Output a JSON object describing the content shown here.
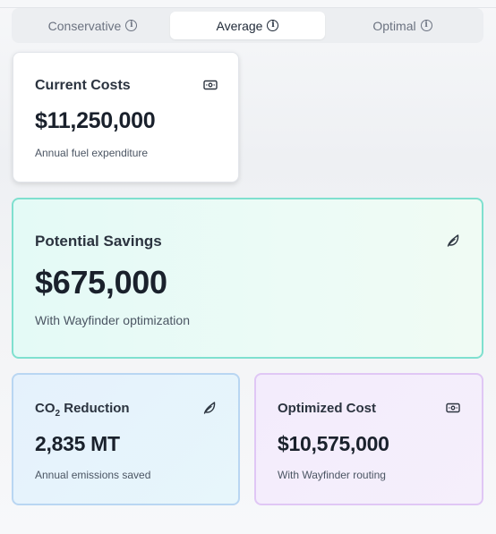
{
  "tabs": [
    {
      "label": "Conservative",
      "info_icon": "info-icon"
    },
    {
      "label": "Average",
      "info_icon": "info-icon",
      "active": true
    },
    {
      "label": "Optimal",
      "info_icon": "info-icon"
    }
  ],
  "cards": {
    "current_costs": {
      "title": "Current Costs",
      "value": "$11,250,000",
      "subtitle": "Annual fuel expenditure",
      "icon": "cash-icon"
    },
    "potential_savings": {
      "title": "Potential Savings",
      "value": "$675,000",
      "subtitle": "With Wayfinder optimization",
      "icon": "leaf-icon"
    },
    "co2_reduction": {
      "title_prefix": "CO",
      "title_sub": "2",
      "title_suffix": " Reduction",
      "value": "2,835 MT",
      "subtitle": "Annual emissions saved",
      "icon": "leaf-icon"
    },
    "optimized_cost": {
      "title": "Optimized Cost",
      "value": "$10,575,000",
      "subtitle": "With Wayfinder routing",
      "icon": "cash-icon"
    }
  },
  "colors": {
    "savings_border": "#7fe0cf",
    "co2_border": "#b9d6f2",
    "optimized_border": "#e0c7f5"
  }
}
